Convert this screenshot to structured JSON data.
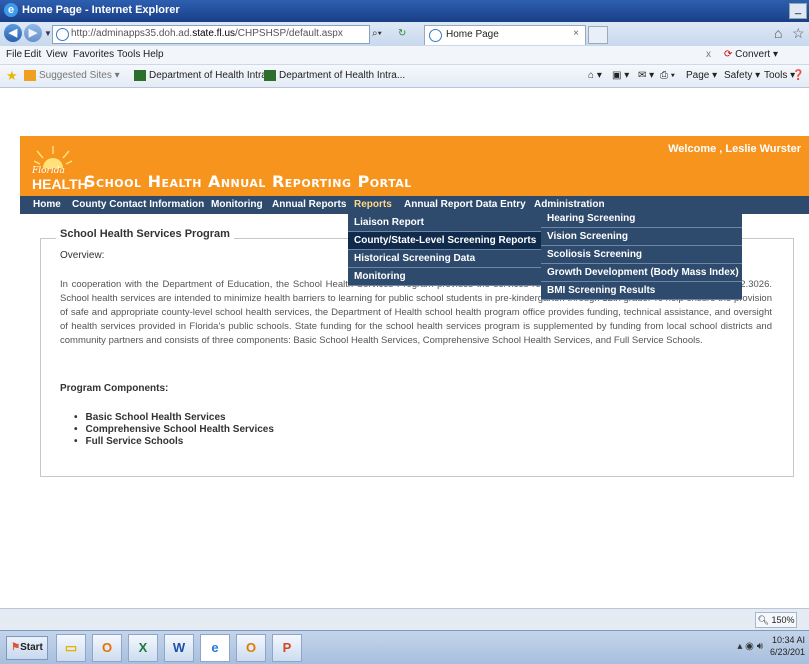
{
  "window": {
    "title": "Home Page - Internet Explorer",
    "minimize": "_"
  },
  "addressbar": {
    "url_prefix": "http://adminapps35.doh.ad.",
    "url_domain": "state.fl.us",
    "url_path": "/CHPSHSP/default.aspx",
    "search_icon": "search-icon",
    "refresh_icon": "refresh-icon",
    "tab_label": "Home Page",
    "tab_close": "×"
  },
  "menubar": {
    "items": [
      "File",
      "Edit",
      "View",
      "Favorites",
      "Tools",
      "Help"
    ],
    "close": "x",
    "convert": "Convert"
  },
  "favorites": {
    "suggested": "Suggested Sites",
    "link1": "Department of Health Intra...",
    "link2": "Department of Health Intra...",
    "page": "Page",
    "safety": "Safety",
    "tools": "Tools"
  },
  "site": {
    "logo_florida": "Florida",
    "logo_health": "HEALTH",
    "portal_title": "School Health Annual Reporting Portal",
    "welcome": "Welcome , Leslie Wurster",
    "nav": [
      "Home",
      "County Contact Information",
      "Monitoring",
      "Annual Reports",
      "Reports",
      "Annual Report Data Entry",
      "Administration"
    ],
    "reports_menu": [
      "Liaison Report",
      "County/State-Level Screening Reports",
      "Historical Screening Data",
      "Monitoring"
    ],
    "screening_submenu": [
      "Hearing Screening",
      "Vision Screening",
      "Scoliosis Screening",
      "Growth Development (Body Mass Index)",
      "BMI Screening Results"
    ]
  },
  "content": {
    "legend": "School Health Services Program",
    "overview": "Overview:",
    "paragraph": "In cooperation with the Department of Education, the School Health Services Program provides the services required by section 381.0056, 381.0057, and 402.3026. School health services are intended to minimize health barriers to learning for public school students in pre-kindergarten through 12th grade. To help ensure the provision of safe and appropriate county-level school health services, the Department of Health school health program office provides funding, technical assistance, and oversight of health services provided in Florida's public schools. State funding for the school health services program is supplemented by funding from local school districts and community partners and consists of three components: Basic School Health Services, Comprehensive School Health Services, and Full Service Schools.",
    "components_title": "Program Components:",
    "components": [
      "Basic School Health Services",
      "Comprehensive School Health Services",
      "Full Service Schools"
    ]
  },
  "status": {
    "zoom": "150%"
  },
  "taskbar": {
    "start": "Start",
    "time": "10:34 AI",
    "date": "6/23/201"
  }
}
